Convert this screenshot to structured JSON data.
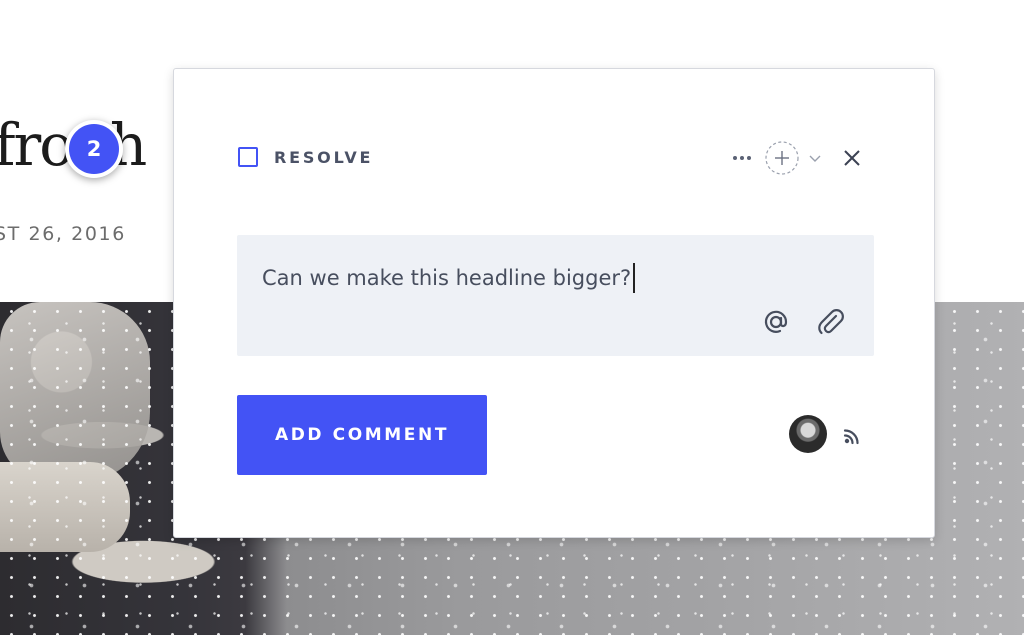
{
  "article": {
    "headline_fragment": "fro  th",
    "date_fragment": "ST 26, 2016"
  },
  "marker": {
    "count": "2"
  },
  "comment_popover": {
    "resolve_label": "RESOLVE",
    "comment_text": "Can we make this headline bigger?",
    "add_comment_label": "ADD COMMENT"
  },
  "icons": {
    "more": "more-horizontal-icon",
    "assign": "add-assignee-icon",
    "chevron": "chevron-down-icon",
    "close": "close-icon",
    "mention": "at-mention-icon",
    "attach": "paperclip-icon",
    "feed": "rss-icon"
  },
  "colors": {
    "accent": "#4353f5",
    "text_dark": "#474e5e",
    "label_gray": "#4b5266",
    "input_bg": "#eef1f6",
    "icon_gray": "#5b6275"
  }
}
